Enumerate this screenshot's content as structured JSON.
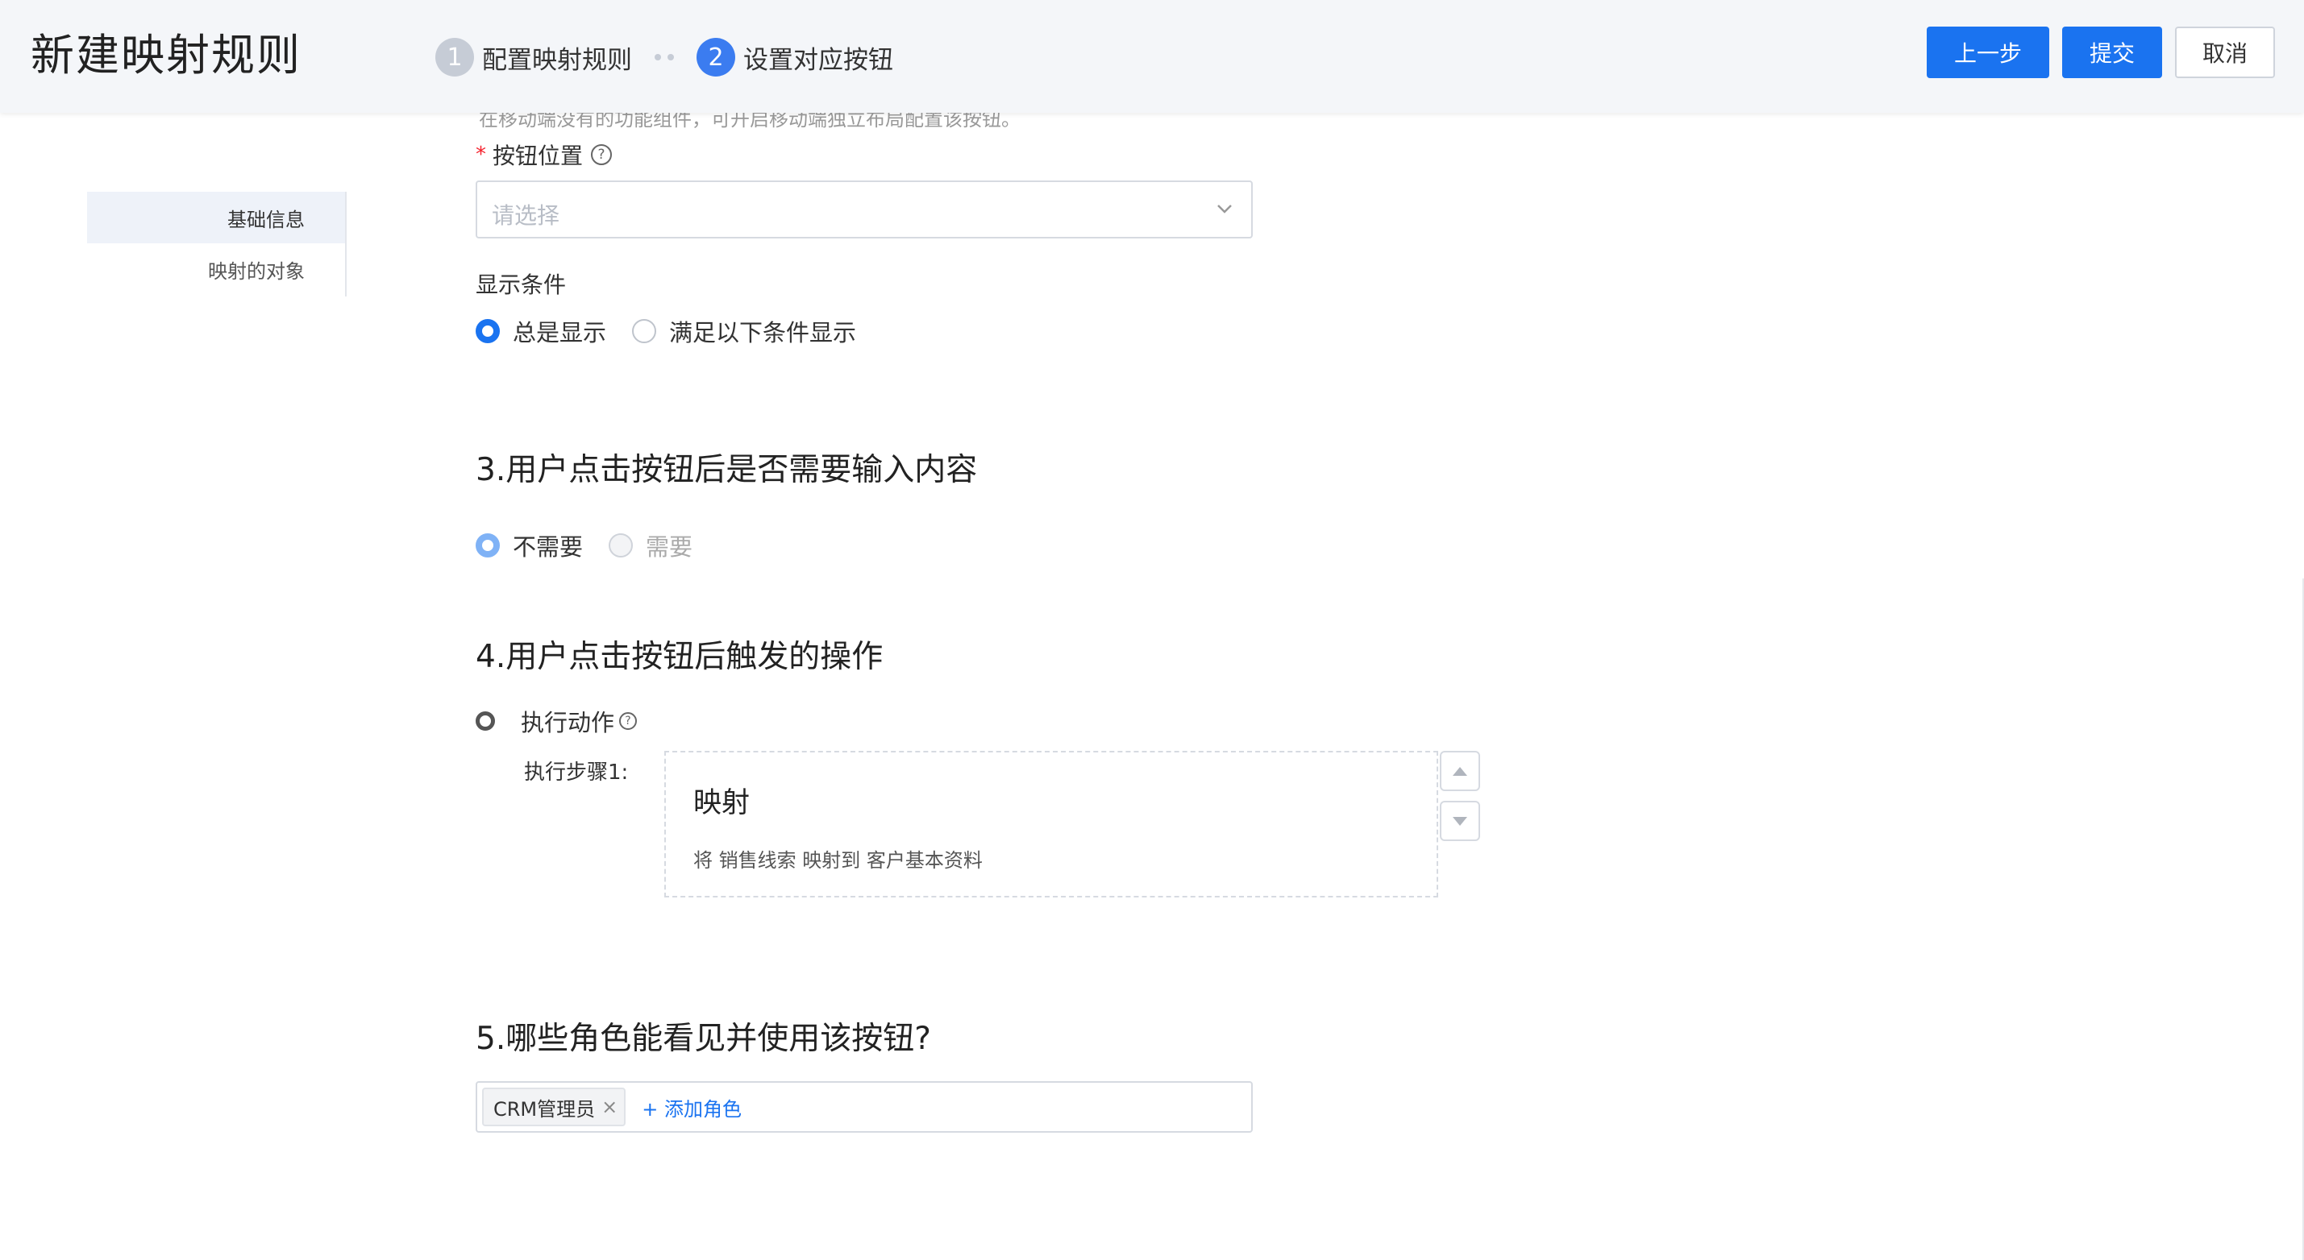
{
  "header": {
    "title": "新建映射规则",
    "steps": [
      {
        "num": "1",
        "label": "配置映射规则"
      },
      {
        "num": "2",
        "label": "设置对应按钮"
      }
    ],
    "buttons": {
      "prev": "上一步",
      "submit": "提交",
      "cancel": "取消"
    }
  },
  "hint_cut": "在移动端没有的功能组件，可开启移动端独立布局配置该按钮。",
  "side_nav": {
    "items": [
      {
        "label": "基础信息",
        "active": true
      },
      {
        "label": "映射的对象",
        "active": false
      }
    ]
  },
  "form": {
    "position": {
      "required_mark": "*",
      "label": "按钮位置",
      "help": "?",
      "placeholder": "请选择"
    },
    "display_condition": {
      "label": "显示条件",
      "options": [
        "总是显示",
        "满足以下条件显示"
      ],
      "selected": "总是显示"
    },
    "section3": {
      "title": "3.用户点击按钮后是否需要输入内容",
      "options": [
        "不需要",
        "需要"
      ],
      "selected": "不需要"
    },
    "section4": {
      "title": "4.用户点击按钮后触发的操作",
      "option": "执行动作",
      "help": "?",
      "step_label": "执行步骤1:",
      "card": {
        "title": "映射",
        "desc": "将 销售线索 映射到 客户基本资料"
      }
    },
    "section5": {
      "title": "5.哪些角色能看见并使用该按钮?",
      "roles": [
        "CRM管理员"
      ],
      "tag_close": "×",
      "add_label": "+ 添加角色"
    }
  },
  "colors": {
    "primary": "#1a73f0",
    "active_step": "#3b7cf0",
    "done_step": "#c6ccd6",
    "required": "#f5222d"
  }
}
